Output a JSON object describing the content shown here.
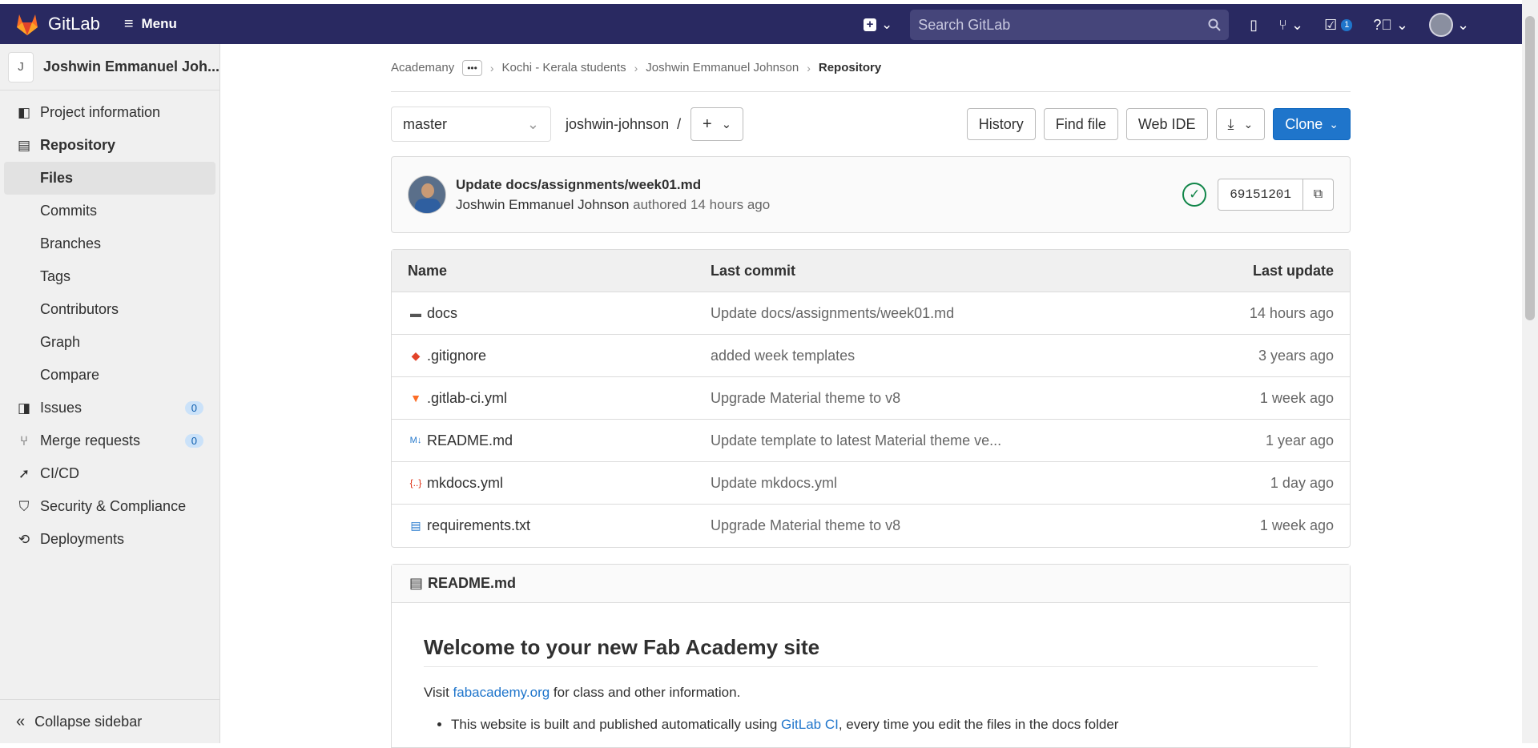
{
  "topbar": {
    "brand": "GitLab",
    "menu_label": "Menu",
    "search_placeholder": "Search GitLab",
    "todo_count": "1"
  },
  "sidebar": {
    "project_initial": "J",
    "project_name": "Joshwin Emmanuel Joh...",
    "items": {
      "project_information": "Project information",
      "repository": "Repository",
      "files": "Files",
      "commits": "Commits",
      "branches": "Branches",
      "tags": "Tags",
      "contributors": "Contributors",
      "graph": "Graph",
      "compare": "Compare",
      "issues": "Issues",
      "issues_count": "0",
      "merge_requests": "Merge requests",
      "merge_requests_count": "0",
      "cicd": "CI/CD",
      "security": "Security & Compliance",
      "deployments": "Deployments"
    },
    "collapse_label": "Collapse sidebar"
  },
  "breadcrumb": {
    "root": "Academany",
    "more": "•••",
    "group": "Kochi - Kerala students",
    "project": "Joshwin Emmanuel Johnson",
    "current": "Repository"
  },
  "toolbar": {
    "branch": "master",
    "path": "joshwin-johnson",
    "path_sep": "/",
    "history": "History",
    "find_file": "Find file",
    "web_ide": "Web IDE",
    "clone": "Clone"
  },
  "commit": {
    "title": "Update docs/assignments/week01.md",
    "author": "Joshwin Emmanuel Johnson",
    "meta": "authored 14 hours ago",
    "sha": "69151201"
  },
  "tree": {
    "headers": {
      "name": "Name",
      "last_commit": "Last commit",
      "last_update": "Last update"
    },
    "rows": [
      {
        "name": "docs",
        "commit": "Update docs/assignments/week01.md",
        "updated": "14 hours ago",
        "icon": "folder-icon"
      },
      {
        "name": ".gitignore",
        "commit": "added week templates",
        "updated": "3 years ago",
        "icon": "git-icon"
      },
      {
        "name": ".gitlab-ci.yml",
        "commit": "Upgrade Material theme to v8",
        "updated": "1 week ago",
        "icon": "gitlab-icon"
      },
      {
        "name": "README.md",
        "commit": "Update template to latest Material theme ve...",
        "updated": "1 year ago",
        "icon": "markdown-icon"
      },
      {
        "name": "mkdocs.yml",
        "commit": "Update mkdocs.yml",
        "updated": "1 day ago",
        "icon": "yaml-icon"
      },
      {
        "name": "requirements.txt",
        "commit": "Upgrade Material theme to v8",
        "updated": "1 week ago",
        "icon": "text-file-icon"
      }
    ]
  },
  "readme": {
    "filename": "README.md",
    "heading": "Welcome to your new Fab Academy site",
    "visit_pre": "Visit ",
    "visit_link": "fabacademy.org",
    "visit_post": " for class and other information.",
    "bullet_pre": "This website is built and published automatically using ",
    "bullet_link": "GitLab CI",
    "bullet_post": ", every time you edit the files in the docs folder"
  },
  "colors": {
    "topbar": "#292961",
    "accent": "#1f75cb",
    "success": "#108548"
  }
}
